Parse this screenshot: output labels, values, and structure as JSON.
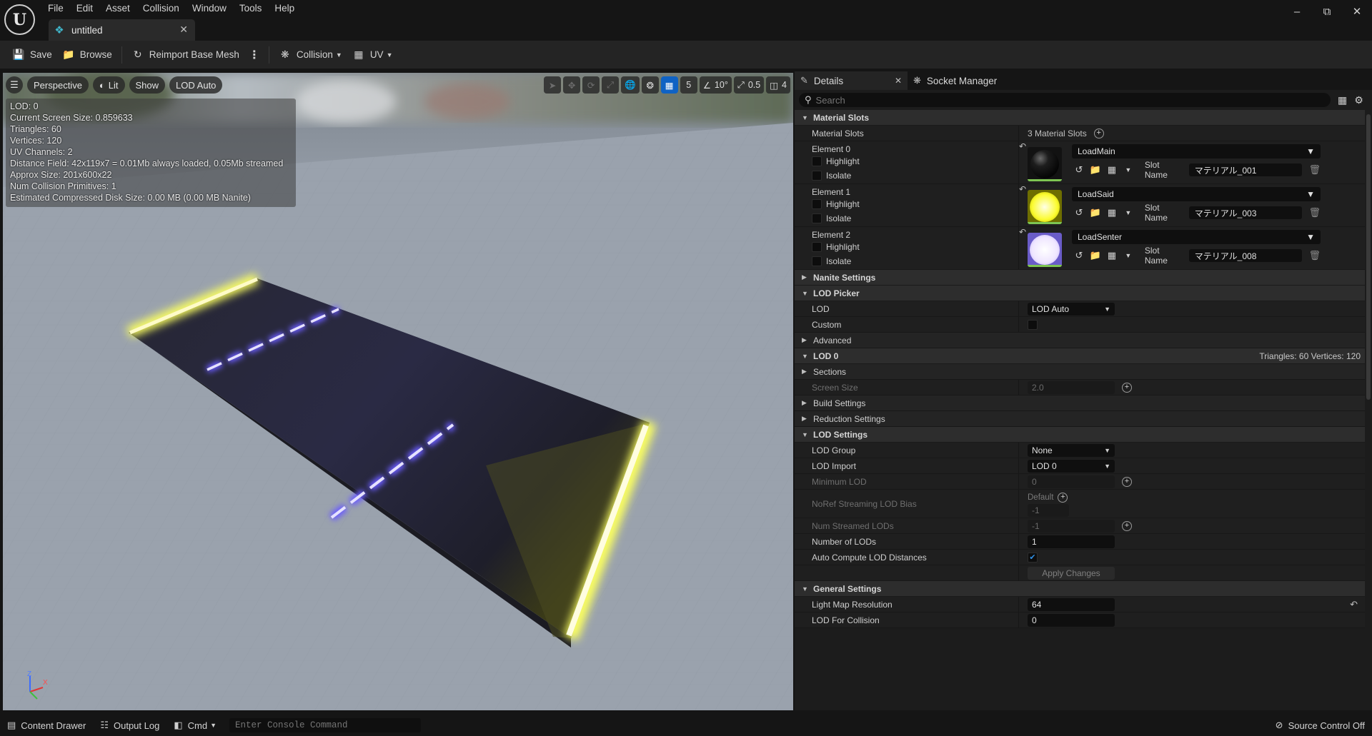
{
  "app": {
    "menu": [
      "File",
      "Edit",
      "Asset",
      "Collision",
      "Window",
      "Tools",
      "Help"
    ],
    "tab_title": "untitled"
  },
  "toolbar": {
    "save": "Save",
    "browse": "Browse",
    "reimport": "Reimport Base Mesh",
    "collision": "Collision",
    "uv": "UV"
  },
  "viewport": {
    "perspective": "Perspective",
    "lit": "Lit",
    "show": "Show",
    "lod": "LOD Auto",
    "grid_snap": "5",
    "angle_snap": "10°",
    "scale_snap": "0.5",
    "camera_speed": "4",
    "stats": [
      "LOD:  0",
      "Current Screen Size:  0.859633",
      "Triangles:  60",
      "Vertices:  120",
      "UV Channels:  2",
      "Distance Field:  42x119x7 = 0.01Mb always loaded, 0.05Mb streamed",
      "Approx Size: 201x600x22",
      "Num Collision Primitives:  1",
      "Estimated Compressed Disk Size: 0.00 MB (0.00 MB Nanite)"
    ],
    "gizmo": {
      "z": "Z",
      "x": "X"
    },
    "colors": {
      "glow_yellow": "#ffff70",
      "glow_blue": "#7a6cff"
    }
  },
  "panel": {
    "tabs": {
      "details": "Details",
      "socket_manager": "Socket Manager"
    },
    "search_placeholder": "Search",
    "material_slots": {
      "header": "Material Slots",
      "label": "Material Slots",
      "count": "3 Material Slots",
      "highlight": "Highlight",
      "isolate": "Isolate",
      "slot_name_label": "Slot Name",
      "elements": [
        {
          "title": "Element 0",
          "material": "LoadMain",
          "slot_name": "マテリアル_001",
          "thumb": "#1a1a1a"
        },
        {
          "title": "Element 1",
          "material": "LoadSaid",
          "slot_name": "マテリアル_003",
          "thumb": "#f4f400"
        },
        {
          "title": "Element 2",
          "material": "LoadSenter",
          "slot_name": "マテリアル_008",
          "thumb": "#ecdcff"
        }
      ]
    },
    "nanite": "Nanite Settings",
    "lod_picker": {
      "header": "LOD Picker",
      "lod_label": "LOD",
      "lod_value": "LOD Auto",
      "custom_label": "Custom",
      "advanced": "Advanced"
    },
    "lod0": {
      "header": "LOD 0",
      "info": "Triangles: 60   Vertices: 120",
      "sections": "Sections",
      "screen_size_label": "Screen Size",
      "screen_size_value": "2.0",
      "build": "Build Settings",
      "reduction": "Reduction Settings"
    },
    "lod_settings": {
      "header": "LOD Settings",
      "lod_group_label": "LOD Group",
      "lod_group_value": "None",
      "lod_import_label": "LOD Import",
      "lod_import_value": "LOD 0",
      "min_lod_label": "Minimum LOD",
      "min_lod_value": "0",
      "noref_label": "NoRef Streaming LOD Bias",
      "noref_default": "Default",
      "noref_value": "-1",
      "num_streamed_label": "Num Streamed LODs",
      "num_streamed_value": "-1",
      "num_lods_label": "Number of LODs",
      "num_lods_value": "1",
      "auto_compute_label": "Auto Compute LOD Distances",
      "apply": "Apply Changes"
    },
    "general": {
      "header": "General Settings",
      "lightmap_label": "Light Map Resolution",
      "lightmap_value": "64",
      "lod_collision_label": "LOD For Collision",
      "lod_collision_value": "0"
    }
  },
  "status": {
    "content_drawer": "Content Drawer",
    "output_log": "Output Log",
    "cmd": "Cmd",
    "console_placeholder": "Enter Console Command",
    "source_control": "Source Control Off"
  }
}
